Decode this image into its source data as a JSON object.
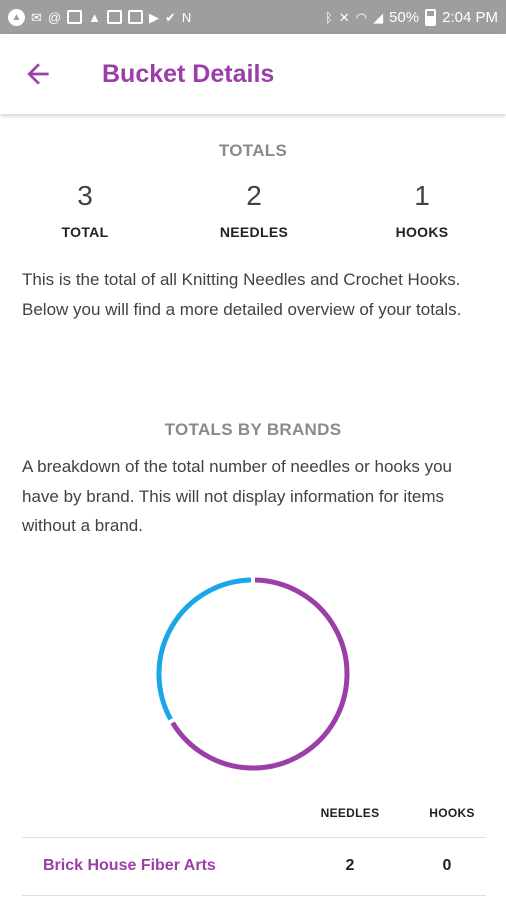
{
  "status_bar": {
    "battery": "50%",
    "time": "2:04 PM",
    "left_icons": [
      "app-circle-icon",
      "gmail-icon",
      "at-icon",
      "image-icon",
      "warning-icon",
      "calendar-icon",
      "card-icon",
      "play-icon",
      "check-icon",
      "n-icon"
    ],
    "right_icons": [
      "bluetooth-icon",
      "mute-icon",
      "wifi-icon",
      "signal-icon",
      "battery-icon"
    ]
  },
  "app_bar": {
    "back_icon": "arrow-back-icon",
    "title": "Bucket Details"
  },
  "totals": {
    "heading": "TOTALS",
    "stats": [
      {
        "value": "3",
        "label": "TOTAL"
      },
      {
        "value": "2",
        "label": "NEEDLES"
      },
      {
        "value": "1",
        "label": "HOOKS"
      }
    ],
    "description": "This is the total of all Knitting Needles and Crochet Hooks. Below you will find a more detailed overview of your totals."
  },
  "brands": {
    "heading": "TOTALS BY BRANDS",
    "description": "A breakdown of the total number of needles or hooks you have by brand. This will not display information for items without a brand.",
    "chart_colors": {
      "needles": "#9b3ea8",
      "hooks": "#1aa7e8"
    },
    "table": {
      "columns": [
        "NEEDLES",
        "HOOKS"
      ],
      "rows": [
        {
          "brand": "Brick House Fiber Arts",
          "needles": "2",
          "hooks": "0"
        }
      ]
    }
  },
  "chart_data": {
    "type": "pie",
    "categories": [
      "NEEDLES",
      "HOOKS"
    ],
    "values": [
      2,
      1
    ]
  },
  "colors": {
    "accent": "#9b3ea8",
    "status_bar": "#9e9e9e",
    "heading_gray": "#8a8a8a"
  }
}
